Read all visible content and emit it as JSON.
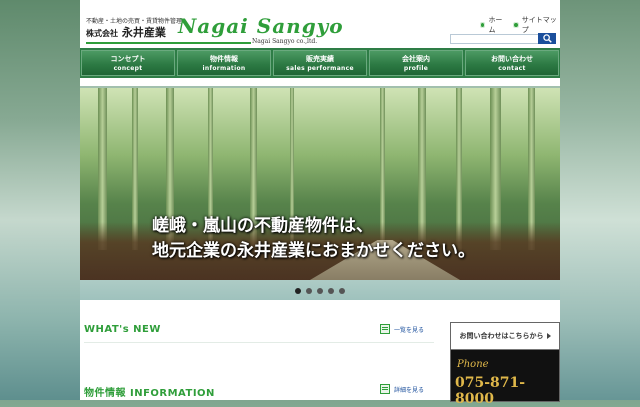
{
  "header": {
    "tagline": "不動産・土地の売買・賃貸物件管理",
    "company_prefix": "株式会社",
    "company_name": "永井産業",
    "logo": "Nagai Sangyo",
    "logo_sub": "Nagai Sangyo co.,ltd.",
    "links": [
      {
        "label": "ホーム"
      },
      {
        "label": "サイトマップ"
      }
    ],
    "search": {
      "placeholder": "",
      "icon": "search-icon"
    }
  },
  "nav": {
    "items": [
      {
        "jp": "コンセプト",
        "en": "concept"
      },
      {
        "jp": "物件情報",
        "en": "information"
      },
      {
        "jp": "販売実績",
        "en": "sales performance"
      },
      {
        "jp": "会社案内",
        "en": "profile"
      },
      {
        "jp": "お問い合わせ",
        "en": "contact"
      }
    ]
  },
  "hero": {
    "line1": "嵯峨・嵐山の不動産物件は、",
    "line2": "地元企業の永井産業におまかせください。"
  },
  "slider": {
    "count": 5,
    "active": 0
  },
  "sections": {
    "news": {
      "title": "WHAT's NEW",
      "link": "一覧を見る"
    },
    "info": {
      "title": "物件情報  INFORMATION",
      "link": "詳細を見る"
    }
  },
  "contact": {
    "header": "お問い合わせはこちらから",
    "phone_label": "Phone",
    "phone_number": "075-871-8000"
  },
  "colors": {
    "brand_green": "#2f9e3a",
    "nav_green": "#2e7d46",
    "accent_gold": "#e0b84a",
    "link_blue": "#1b4f9c"
  }
}
